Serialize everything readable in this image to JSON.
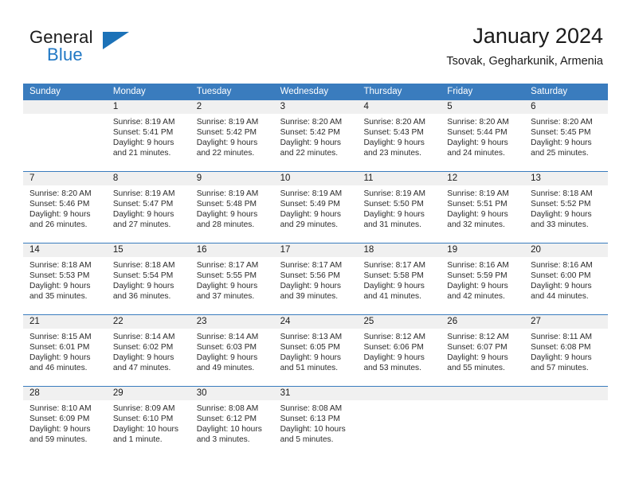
{
  "brand": {
    "general": "General",
    "blue": "Blue",
    "flag_icon": "triangle-flag-icon"
  },
  "header": {
    "title": "January 2024",
    "subtitle": "Tsovak, Gegharkunik, Armenia"
  },
  "colors": {
    "header_blue": "#3a7cbe",
    "brand_blue": "#1f77c4",
    "day_band_gray": "#f0f0f0",
    "text": "#1a1a1a"
  },
  "weekdays": [
    "Sunday",
    "Monday",
    "Tuesday",
    "Wednesday",
    "Thursday",
    "Friday",
    "Saturday"
  ],
  "weeks": [
    [
      {
        "day": "",
        "lines": []
      },
      {
        "day": "1",
        "lines": [
          "Sunrise: 8:19 AM",
          "Sunset: 5:41 PM",
          "Daylight: 9 hours",
          "and 21 minutes."
        ]
      },
      {
        "day": "2",
        "lines": [
          "Sunrise: 8:19 AM",
          "Sunset: 5:42 PM",
          "Daylight: 9 hours",
          "and 22 minutes."
        ]
      },
      {
        "day": "3",
        "lines": [
          "Sunrise: 8:20 AM",
          "Sunset: 5:42 PM",
          "Daylight: 9 hours",
          "and 22 minutes."
        ]
      },
      {
        "day": "4",
        "lines": [
          "Sunrise: 8:20 AM",
          "Sunset: 5:43 PM",
          "Daylight: 9 hours",
          "and 23 minutes."
        ]
      },
      {
        "day": "5",
        "lines": [
          "Sunrise: 8:20 AM",
          "Sunset: 5:44 PM",
          "Daylight: 9 hours",
          "and 24 minutes."
        ]
      },
      {
        "day": "6",
        "lines": [
          "Sunrise: 8:20 AM",
          "Sunset: 5:45 PM",
          "Daylight: 9 hours",
          "and 25 minutes."
        ]
      }
    ],
    [
      {
        "day": "7",
        "lines": [
          "Sunrise: 8:20 AM",
          "Sunset: 5:46 PM",
          "Daylight: 9 hours",
          "and 26 minutes."
        ]
      },
      {
        "day": "8",
        "lines": [
          "Sunrise: 8:19 AM",
          "Sunset: 5:47 PM",
          "Daylight: 9 hours",
          "and 27 minutes."
        ]
      },
      {
        "day": "9",
        "lines": [
          "Sunrise: 8:19 AM",
          "Sunset: 5:48 PM",
          "Daylight: 9 hours",
          "and 28 minutes."
        ]
      },
      {
        "day": "10",
        "lines": [
          "Sunrise: 8:19 AM",
          "Sunset: 5:49 PM",
          "Daylight: 9 hours",
          "and 29 minutes."
        ]
      },
      {
        "day": "11",
        "lines": [
          "Sunrise: 8:19 AM",
          "Sunset: 5:50 PM",
          "Daylight: 9 hours",
          "and 31 minutes."
        ]
      },
      {
        "day": "12",
        "lines": [
          "Sunrise: 8:19 AM",
          "Sunset: 5:51 PM",
          "Daylight: 9 hours",
          "and 32 minutes."
        ]
      },
      {
        "day": "13",
        "lines": [
          "Sunrise: 8:18 AM",
          "Sunset: 5:52 PM",
          "Daylight: 9 hours",
          "and 33 minutes."
        ]
      }
    ],
    [
      {
        "day": "14",
        "lines": [
          "Sunrise: 8:18 AM",
          "Sunset: 5:53 PM",
          "Daylight: 9 hours",
          "and 35 minutes."
        ]
      },
      {
        "day": "15",
        "lines": [
          "Sunrise: 8:18 AM",
          "Sunset: 5:54 PM",
          "Daylight: 9 hours",
          "and 36 minutes."
        ]
      },
      {
        "day": "16",
        "lines": [
          "Sunrise: 8:17 AM",
          "Sunset: 5:55 PM",
          "Daylight: 9 hours",
          "and 37 minutes."
        ]
      },
      {
        "day": "17",
        "lines": [
          "Sunrise: 8:17 AM",
          "Sunset: 5:56 PM",
          "Daylight: 9 hours",
          "and 39 minutes."
        ]
      },
      {
        "day": "18",
        "lines": [
          "Sunrise: 8:17 AM",
          "Sunset: 5:58 PM",
          "Daylight: 9 hours",
          "and 41 minutes."
        ]
      },
      {
        "day": "19",
        "lines": [
          "Sunrise: 8:16 AM",
          "Sunset: 5:59 PM",
          "Daylight: 9 hours",
          "and 42 minutes."
        ]
      },
      {
        "day": "20",
        "lines": [
          "Sunrise: 8:16 AM",
          "Sunset: 6:00 PM",
          "Daylight: 9 hours",
          "and 44 minutes."
        ]
      }
    ],
    [
      {
        "day": "21",
        "lines": [
          "Sunrise: 8:15 AM",
          "Sunset: 6:01 PM",
          "Daylight: 9 hours",
          "and 46 minutes."
        ]
      },
      {
        "day": "22",
        "lines": [
          "Sunrise: 8:14 AM",
          "Sunset: 6:02 PM",
          "Daylight: 9 hours",
          "and 47 minutes."
        ]
      },
      {
        "day": "23",
        "lines": [
          "Sunrise: 8:14 AM",
          "Sunset: 6:03 PM",
          "Daylight: 9 hours",
          "and 49 minutes."
        ]
      },
      {
        "day": "24",
        "lines": [
          "Sunrise: 8:13 AM",
          "Sunset: 6:05 PM",
          "Daylight: 9 hours",
          "and 51 minutes."
        ]
      },
      {
        "day": "25",
        "lines": [
          "Sunrise: 8:12 AM",
          "Sunset: 6:06 PM",
          "Daylight: 9 hours",
          "and 53 minutes."
        ]
      },
      {
        "day": "26",
        "lines": [
          "Sunrise: 8:12 AM",
          "Sunset: 6:07 PM",
          "Daylight: 9 hours",
          "and 55 minutes."
        ]
      },
      {
        "day": "27",
        "lines": [
          "Sunrise: 8:11 AM",
          "Sunset: 6:08 PM",
          "Daylight: 9 hours",
          "and 57 minutes."
        ]
      }
    ],
    [
      {
        "day": "28",
        "lines": [
          "Sunrise: 8:10 AM",
          "Sunset: 6:09 PM",
          "Daylight: 9 hours",
          "and 59 minutes."
        ]
      },
      {
        "day": "29",
        "lines": [
          "Sunrise: 8:09 AM",
          "Sunset: 6:10 PM",
          "Daylight: 10 hours",
          "and 1 minute."
        ]
      },
      {
        "day": "30",
        "lines": [
          "Sunrise: 8:08 AM",
          "Sunset: 6:12 PM",
          "Daylight: 10 hours",
          "and 3 minutes."
        ]
      },
      {
        "day": "31",
        "lines": [
          "Sunrise: 8:08 AM",
          "Sunset: 6:13 PM",
          "Daylight: 10 hours",
          "and 5 minutes."
        ]
      },
      {
        "day": "",
        "lines": []
      },
      {
        "day": "",
        "lines": []
      },
      {
        "day": "",
        "lines": []
      }
    ]
  ]
}
